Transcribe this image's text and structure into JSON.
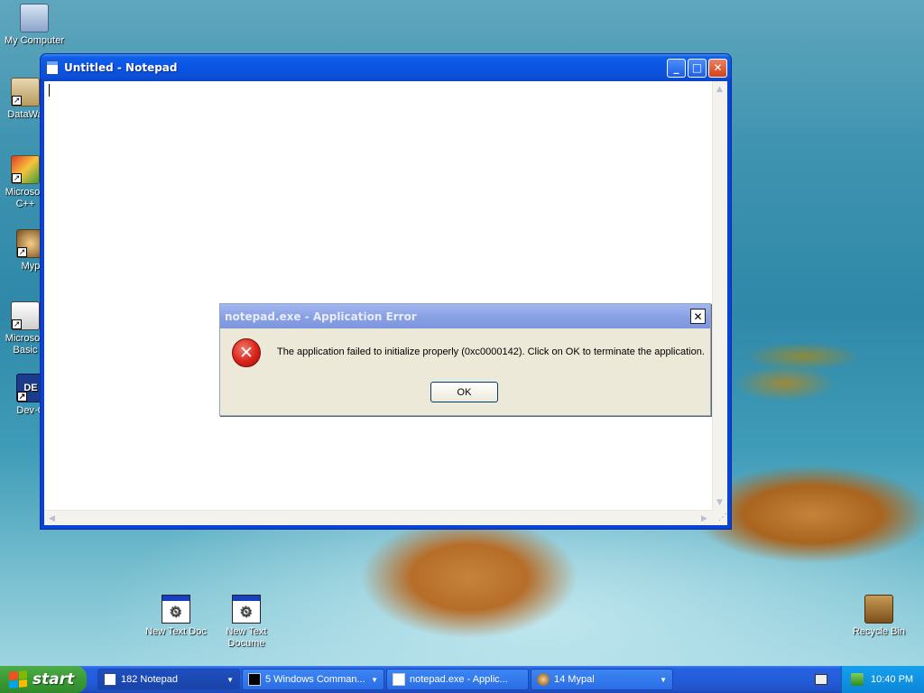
{
  "desktop": {
    "icons": [
      {
        "label": "My Computer",
        "icon": "computer-icon"
      },
      {
        "label": "DataWa",
        "icon": "database-shortcut-icon"
      },
      {
        "label": "Microsoft C++",
        "icon": "visual-cpp-shortcut-icon"
      },
      {
        "label": "Myp",
        "icon": "mypal-shortcut-icon"
      },
      {
        "label": "Microsoft Basic",
        "icon": "small-basic-shortcut-icon"
      },
      {
        "label": "Dev-C",
        "icon": "dev-cpp-shortcut-icon"
      },
      {
        "label": "New Text Doc",
        "icon": "text-document-icon"
      },
      {
        "label": "New Text Docume",
        "icon": "text-document-icon"
      },
      {
        "label": "Recycle Bin",
        "icon": "recycle-bin-icon"
      }
    ],
    "dev_icon_text": "DE"
  },
  "notepad": {
    "title": "Untitled - Notepad",
    "minimize": "_",
    "maximize": "□",
    "close": "✕",
    "content": ""
  },
  "dialog": {
    "title": "notepad.exe - Application Error",
    "close": "✕",
    "icon": "error-icon",
    "icon_glyph": "✕",
    "message": "The application failed to initialize properly (0xc0000142). Click on OK to terminate the application.",
    "ok_label": "OK"
  },
  "taskbar": {
    "start_label": "start",
    "tasks": [
      {
        "label": "182 Notepad",
        "icon": "notepad-icon"
      },
      {
        "label": "5 Windows Comman...",
        "icon": "console-icon"
      },
      {
        "label": "notepad.exe - Applic...",
        "icon": "window-icon"
      },
      {
        "label": "14 Mypal",
        "icon": "mypal-icon"
      }
    ],
    "clock": "10:40 PM"
  },
  "colors": {
    "titlebar_blue": "#0a55e4",
    "taskbar_blue": "#245edb",
    "start_green": "#3b9c36",
    "dialog_face": "#ece9d8",
    "error_red": "#d8231a"
  }
}
